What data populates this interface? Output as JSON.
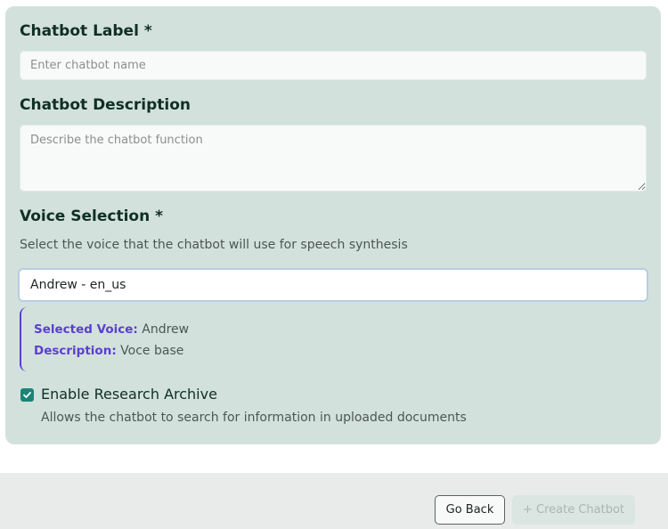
{
  "form": {
    "label_title": "Chatbot Label *",
    "label_placeholder": "Enter chatbot name",
    "description_title": "Chatbot Description",
    "description_placeholder": "Describe the chatbot function",
    "voice_title": "Voice Selection *",
    "voice_hint": "Select the voice that the chatbot will use for speech synthesis",
    "voice_selected_value": "Andrew - en_us",
    "voice_info": {
      "selected_key": "Selected Voice:",
      "selected_value": "Andrew",
      "description_key": "Description:",
      "description_value": "Voce base"
    },
    "research_archive": {
      "label": "Enable Research Archive",
      "help": "Allows the chatbot to search for information in uploaded documents",
      "checked": true
    }
  },
  "footer": {
    "back_label": "Go Back",
    "create_label": "+ Create Chatbot"
  },
  "colors": {
    "accent": "#1a8576",
    "voice_info_accent": "#5a3fd0",
    "panel_bg": "#d3e1dc"
  }
}
